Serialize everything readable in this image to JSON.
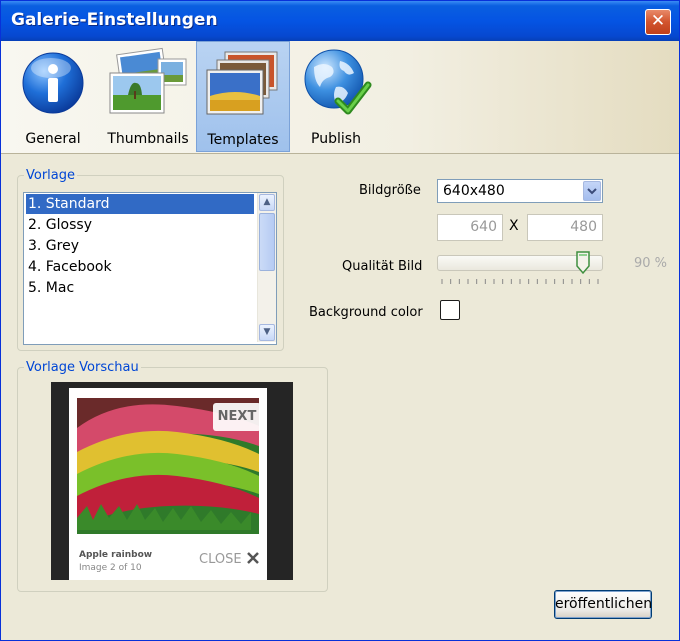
{
  "window": {
    "title": "Galerie-Einstellungen",
    "close_glyph": "✕"
  },
  "toolbar": {
    "items": [
      {
        "label": "General",
        "icon": "info-icon",
        "active": false
      },
      {
        "label": "Thumbnails",
        "icon": "thumbnails-icon",
        "active": false
      },
      {
        "label": "Templates",
        "icon": "templates-icon",
        "active": true
      },
      {
        "label": "Publish",
        "icon": "globe-publish-icon",
        "active": false
      }
    ]
  },
  "vorlage": {
    "legend": "Vorlage",
    "items": [
      "1. Standard",
      "2. Glossy",
      "3. Grey",
      "4. Facebook",
      "5. Mac"
    ],
    "selected_index": 0
  },
  "settings": {
    "bildgroesse_label": "Bildgröße",
    "bildgroesse_value": "640x480",
    "width": "640",
    "x_label": "X",
    "height": "480",
    "qualitaet_label": "Qualität Bild",
    "qualitaet_value": "90 %",
    "qualitaet_level": 0.9,
    "background_label": "Background color",
    "background_checked": false
  },
  "preview": {
    "legend": "Vorlage Vorschau",
    "next_label": "NEXT",
    "caption_title": "Apple rainbow",
    "caption_sub": "Image 2 of 10",
    "close_label": "CLOSE"
  },
  "footer": {
    "publish_label": "eröffentlichen."
  },
  "colors": {
    "title_bar": "#0554e3",
    "selection": "#316ac5",
    "legend": "#0046d5"
  }
}
